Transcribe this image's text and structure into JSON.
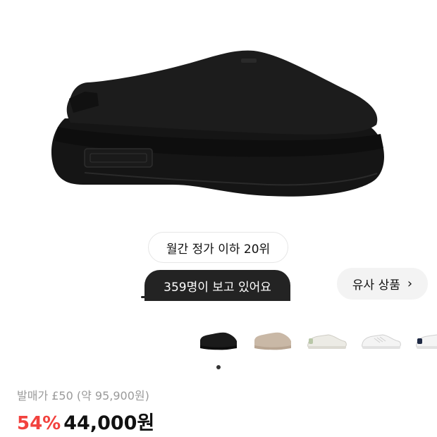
{
  "product": {
    "image_icon": "black-clog-shoe",
    "rank_badge": "월간 정가 이하 20위",
    "viewers_label": "359명이 보고 있어요",
    "similar_button": "유사 상품",
    "similar_chevron": "›"
  },
  "thumbnails": [
    {
      "icon": "black-clog-shoe",
      "color": "#1a1a1a"
    },
    {
      "icon": "beige-clog-shoe",
      "color": "#c9b8a6"
    },
    {
      "icon": "white-sneaker-green-heel",
      "color": "#ecebe5"
    },
    {
      "icon": "white-sneaker",
      "color": "#f2f2f2"
    },
    {
      "icon": "white-sneaker-navy-heel",
      "color": "#f2f2f2"
    }
  ],
  "price": {
    "original": "발매가 £50 (약 95,900원)",
    "discount": "54%",
    "sale": "44,000원"
  },
  "colors": {
    "discount_red": "#f2423e",
    "dark_pill": "#232323"
  }
}
